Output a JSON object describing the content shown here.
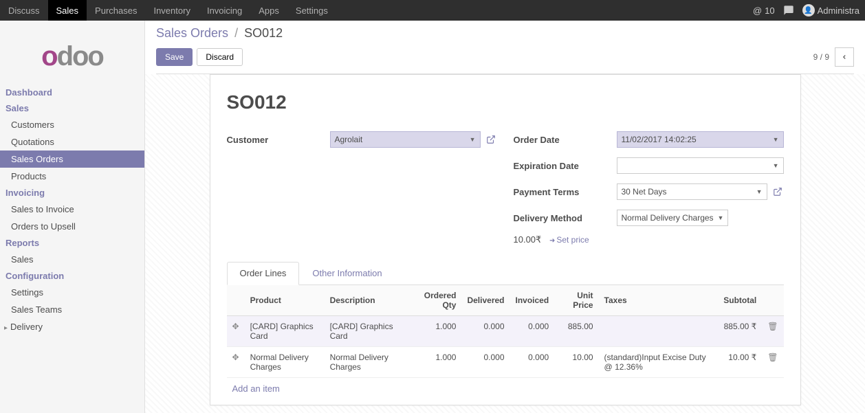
{
  "topnav": {
    "items": [
      "Discuss",
      "Sales",
      "Purchases",
      "Inventory",
      "Invoicing",
      "Apps",
      "Settings"
    ],
    "active": "Sales",
    "inbox_count": "10",
    "user_name": "Administra"
  },
  "sidebar": {
    "groups": [
      {
        "title": "Dashboard",
        "items": []
      },
      {
        "title": "Sales",
        "items": [
          {
            "label": "Customers"
          },
          {
            "label": "Quotations"
          },
          {
            "label": "Sales Orders",
            "selected": true
          },
          {
            "label": "Products"
          }
        ]
      },
      {
        "title": "Invoicing",
        "items": [
          {
            "label": "Sales to Invoice"
          },
          {
            "label": "Orders to Upsell"
          }
        ]
      },
      {
        "title": "Reports",
        "items": [
          {
            "label": "Sales"
          }
        ]
      },
      {
        "title": "Configuration",
        "items": [
          {
            "label": "Settings"
          },
          {
            "label": "Sales Teams"
          },
          {
            "label": "Delivery",
            "expandable": true
          }
        ]
      }
    ]
  },
  "breadcrumb": {
    "parent": "Sales Orders",
    "current": "SO012"
  },
  "buttons": {
    "save": "Save",
    "discard": "Discard"
  },
  "pager": {
    "text": "9 / 9"
  },
  "record": {
    "name": "SO012",
    "customer_label": "Customer",
    "customer": "Agrolait",
    "order_date_label": "Order Date",
    "order_date": "11/02/2017 14:02:25",
    "expiration_label": "Expiration Date",
    "expiration": "",
    "payment_terms_label": "Payment Terms",
    "payment_terms": "30 Net Days",
    "delivery_method_label": "Delivery Method",
    "delivery_method": "Normal Delivery Charges",
    "delivery_price": "10.00₹",
    "set_price_label": "Set price"
  },
  "tabs": {
    "order_lines": "Order Lines",
    "other_info": "Other Information"
  },
  "lines": {
    "headers": {
      "product": "Product",
      "description": "Description",
      "ordered_qty": "Ordered Qty",
      "delivered": "Delivered",
      "invoiced": "Invoiced",
      "unit_price": "Unit Price",
      "taxes": "Taxes",
      "subtotal": "Subtotal"
    },
    "rows": [
      {
        "product": "[CARD] Graphics Card",
        "description": "[CARD] Graphics Card",
        "ordered_qty": "1.000",
        "delivered": "0.000",
        "invoiced": "0.000",
        "unit_price": "885.00",
        "taxes": "",
        "subtotal": "885.00 ₹"
      },
      {
        "product": "Normal Delivery Charges",
        "description": "Normal Delivery Charges",
        "ordered_qty": "1.000",
        "delivered": "0.000",
        "invoiced": "0.000",
        "unit_price": "10.00",
        "taxes": "(standard)Input Excise Duty @ 12.36%",
        "subtotal": "10.00 ₹"
      }
    ],
    "add_item": "Add an item"
  }
}
